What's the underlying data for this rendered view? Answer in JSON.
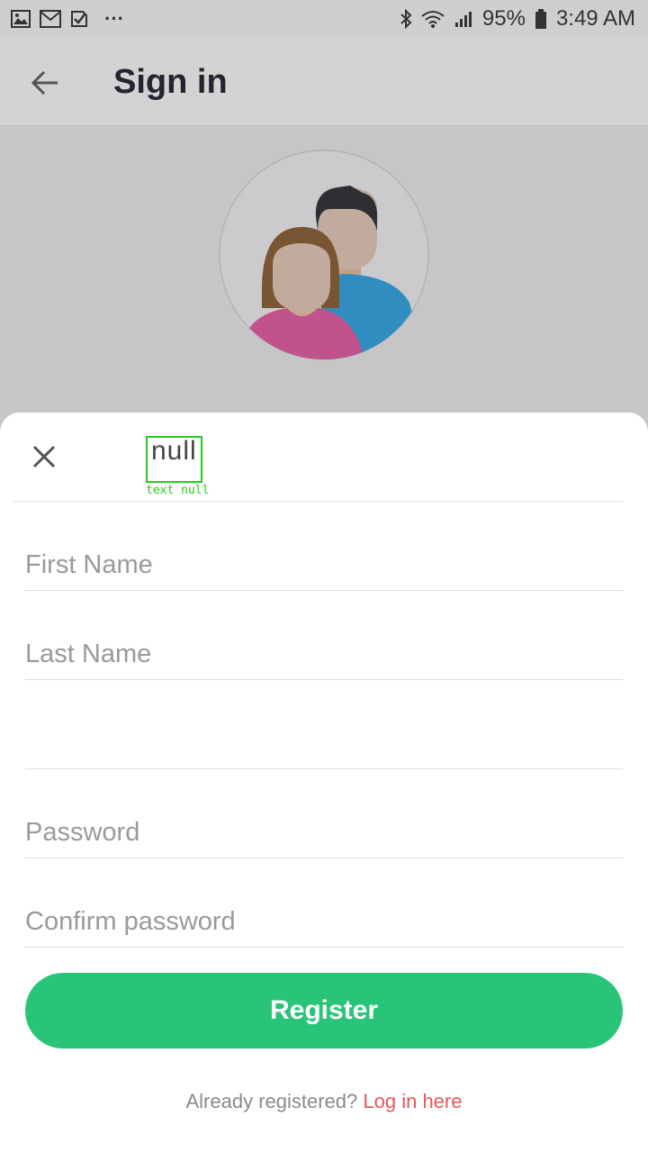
{
  "status_bar": {
    "battery": "95%",
    "time": "3:49 AM",
    "left_icons": [
      "gallery-icon",
      "gmail-icon",
      "tasks-icon",
      "more-dots-icon"
    ],
    "right_icons": [
      "bluetooth-icon",
      "wifi-icon",
      "signal-icon",
      "battery-icon"
    ],
    "more": "···"
  },
  "toolbar": {
    "title": "Sign in",
    "back_icon": "arrow-left-icon"
  },
  "sheet": {
    "title": "null",
    "debug_label": "text null",
    "close_icon": "close-icon"
  },
  "form": {
    "first_name_placeholder": "First Name",
    "last_name_placeholder": "Last Name",
    "email_placeholder": "",
    "password_placeholder": "Password",
    "confirm_password_placeholder": "Confirm password",
    "register_label": "Register"
  },
  "footer": {
    "prompt": "Already registered? ",
    "link": "Log in here"
  },
  "colors": {
    "accent": "#28c477",
    "link": "#e3585a",
    "header_bg": "#c6c6c8",
    "toolbar_bg": "#d3d3d3"
  }
}
